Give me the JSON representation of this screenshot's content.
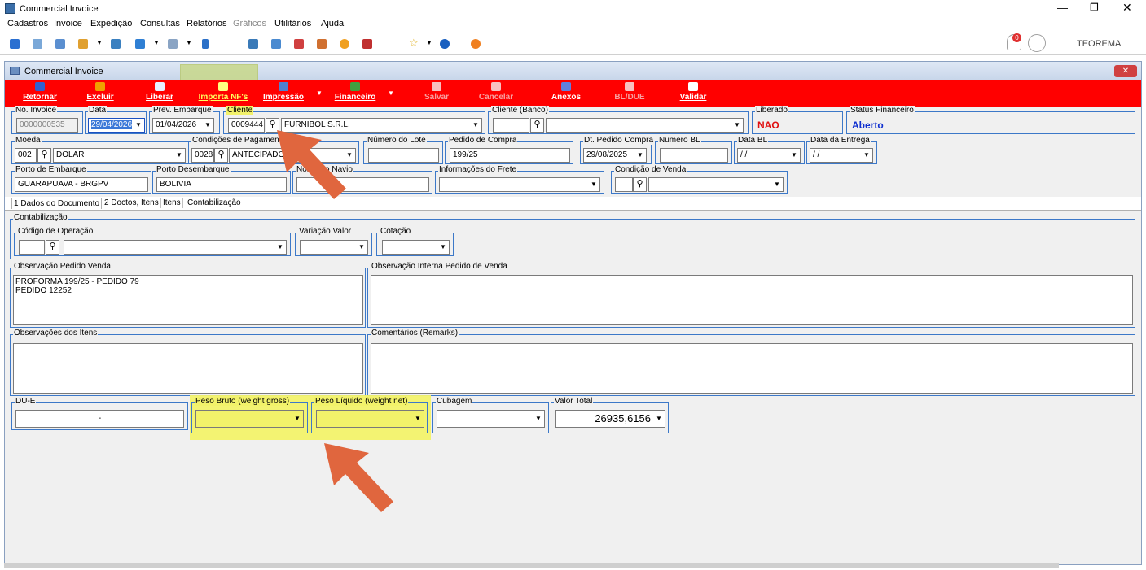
{
  "window": {
    "title": "Commercial Invoice"
  },
  "menu": [
    "Cadastros",
    "Invoice",
    "Expedição",
    "Consultas",
    "Relatórios",
    "Gráficos",
    "Utilitários",
    "Ajuda"
  ],
  "user": {
    "name": "TEOREMA",
    "notification_count": "0"
  },
  "form": {
    "title": "Commercial Invoice",
    "toolbar": {
      "retornar": "Retornar",
      "excluir": "Excluir",
      "liberar": "Liberar",
      "importa": "Importa NF's",
      "impressao": "Impressão",
      "financeiro": "Financeiro",
      "salvar": "Salvar",
      "cancelar": "Cancelar",
      "anexos": "Anexos",
      "bldue": "BL/DUE",
      "validar": "Validar"
    },
    "row1": {
      "no_invoice_label": "No. Invoice",
      "no_invoice": "0000000535",
      "data_label": "Data",
      "data": "29/04/2026",
      "prev_embarque_label": "Prev. Embarque",
      "prev_embarque": "01/04/2026",
      "cliente_label": "Cliente",
      "cliente_code": "0009444",
      "cliente_name": "FURNIBOL S.R.L.",
      "cliente_banco_label": "Cliente (Banco)",
      "cliente_banco_code": "",
      "cliente_banco_name": "",
      "liberado_label": "Liberado",
      "liberado": "NAO",
      "status_fin_label": "Status Financeiro",
      "status_fin": "Aberto"
    },
    "row2": {
      "moeda_label": "Moeda",
      "moeda_code": "002",
      "moeda_name": "DOLAR",
      "cond_pag_label": "Condições de Pagamento",
      "cond_pag_code": "0028",
      "cond_pag_name": "ANTECIPADO",
      "numero_lote_label": "Número do Lote",
      "numero_lote": "",
      "pedido_compra_label": "Pedido de Compra",
      "pedido_compra": "199/25",
      "dt_pedido_label": "Dt. Pedido Compra",
      "dt_pedido": "29/08/2025",
      "numero_bl_label": "Numero BL",
      "numero_bl": "",
      "data_bl_label": "Data BL",
      "data_bl": "/ /",
      "data_entrega_label": "Data da Entrega",
      "data_entrega": "/ /"
    },
    "row3": {
      "porto_emb_label": "Porto de Embarque",
      "porto_emb": "GUARAPUAVA - BRGPV",
      "porto_des_label": "Porto Desembarque",
      "porto_des": "BOLIVIA",
      "nome_navio_label": "Nome do Navio",
      "nome_navio": "",
      "info_frete_label": "Informações do Frete",
      "info_frete": "",
      "cond_venda_label": "Condição de Venda",
      "cond_venda_code": "",
      "cond_venda_name": ""
    },
    "tabs": [
      "1 Dados do Documento",
      "2 Doctos, Itens",
      "Itens",
      "Contabilização"
    ],
    "contab": {
      "group_label": "Contabilização",
      "cod_op_label": "Código de Operação",
      "variacao_label": "Variação Valor",
      "cotacao_label": "Cotação"
    },
    "obs_pedido_label": "Observação Pedido Venda",
    "obs_pedido": "PROFORMA 199/25 - PEDIDO 79\nPEDIDO 12252",
    "obs_interna_label": "Observação Interna Pedido de Venda",
    "obs_itens_label": "Observações dos Itens",
    "comentarios_label": "Comentários (Remarks)",
    "bottom": {
      "due_label": "DU-E",
      "due": "-",
      "peso_bruto_label": "Peso Bruto (weight gross)",
      "peso_liquido_label": "Peso Líquido (weight net)",
      "cubagem_label": "Cubagem",
      "valor_total_label": "Valor Total",
      "valor_total": "26935,6156"
    }
  },
  "colors": {
    "red_toolbar": "#ff0000",
    "highlight": "#f2f26a",
    "arrow": "#e0663e",
    "group_border": "#3c78c8"
  }
}
